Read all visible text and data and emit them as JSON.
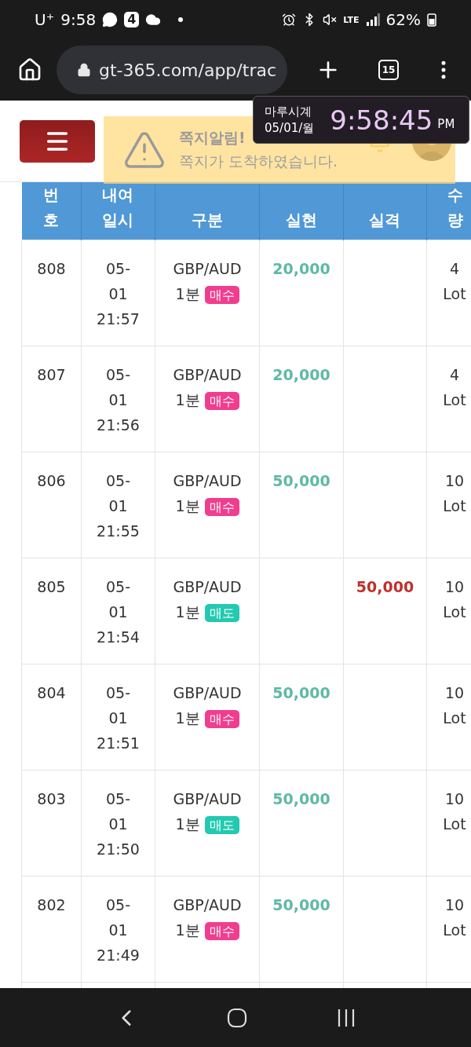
{
  "status_bar": {
    "carrier": "U⁺",
    "time": "9:58",
    "notification_count": "4",
    "network": "LTE",
    "battery": "62%"
  },
  "browser": {
    "url": "gt-365.com/app/trac",
    "tab_count": "15"
  },
  "clock_widget": {
    "title": "마루시계",
    "date": "05/01/월",
    "time": "9:58:45",
    "meridiem": "PM"
  },
  "toast": {
    "title": "쪽지알림!",
    "message": "쪽지가 도착하였습니다."
  },
  "table": {
    "columns": [
      [
        "번",
        "호"
      ],
      [
        "내여",
        "일시"
      ],
      [
        "구분"
      ],
      [
        "실현"
      ],
      [
        "실격"
      ],
      [
        "수",
        "량"
      ]
    ],
    "rows": [
      {
        "no": "808",
        "date": [
          "05-",
          "01",
          "21:57"
        ],
        "pair": "GBP/AUD",
        "period": "1분",
        "side": {
          "label": "매수",
          "kind": "buy"
        },
        "profit": "20,000",
        "qty": [
          "4",
          "Lot"
        ]
      },
      {
        "no": "807",
        "date": [
          "05-",
          "01",
          "21:56"
        ],
        "pair": "GBP/AUD",
        "period": "1분",
        "side": {
          "label": "매수",
          "kind": "buy"
        },
        "profit": "20,000",
        "qty": [
          "4",
          "Lot"
        ]
      },
      {
        "no": "806",
        "date": [
          "05-",
          "01",
          "21:55"
        ],
        "pair": "GBP/AUD",
        "period": "1분",
        "side": {
          "label": "매수",
          "kind": "buy"
        },
        "profit": "50,000",
        "qty": [
          "10",
          "Lot"
        ]
      },
      {
        "no": "805",
        "date": [
          "05-",
          "01",
          "21:54"
        ],
        "pair": "GBP/AUD",
        "period": "1분",
        "side": {
          "label": "매도",
          "kind": "sell"
        },
        "loss": "50,000",
        "qty": [
          "10",
          "Lot"
        ]
      },
      {
        "no": "804",
        "date": [
          "05-",
          "01",
          "21:51"
        ],
        "pair": "GBP/AUD",
        "period": "1분",
        "side": {
          "label": "매수",
          "kind": "buy"
        },
        "profit": "50,000",
        "qty": [
          "10",
          "Lot"
        ]
      },
      {
        "no": "803",
        "date": [
          "05-",
          "01",
          "21:50"
        ],
        "pair": "GBP/AUD",
        "period": "1분",
        "side": {
          "label": "매도",
          "kind": "sell"
        },
        "profit": "50,000",
        "qty": [
          "10",
          "Lot"
        ]
      },
      {
        "no": "802",
        "date": [
          "05-",
          "01",
          "21:49"
        ],
        "pair": "GBP/AUD",
        "period": "1분",
        "side": {
          "label": "매수",
          "kind": "buy"
        },
        "profit": "50,000",
        "qty": [
          "10",
          "Lot"
        ]
      }
    ]
  }
}
